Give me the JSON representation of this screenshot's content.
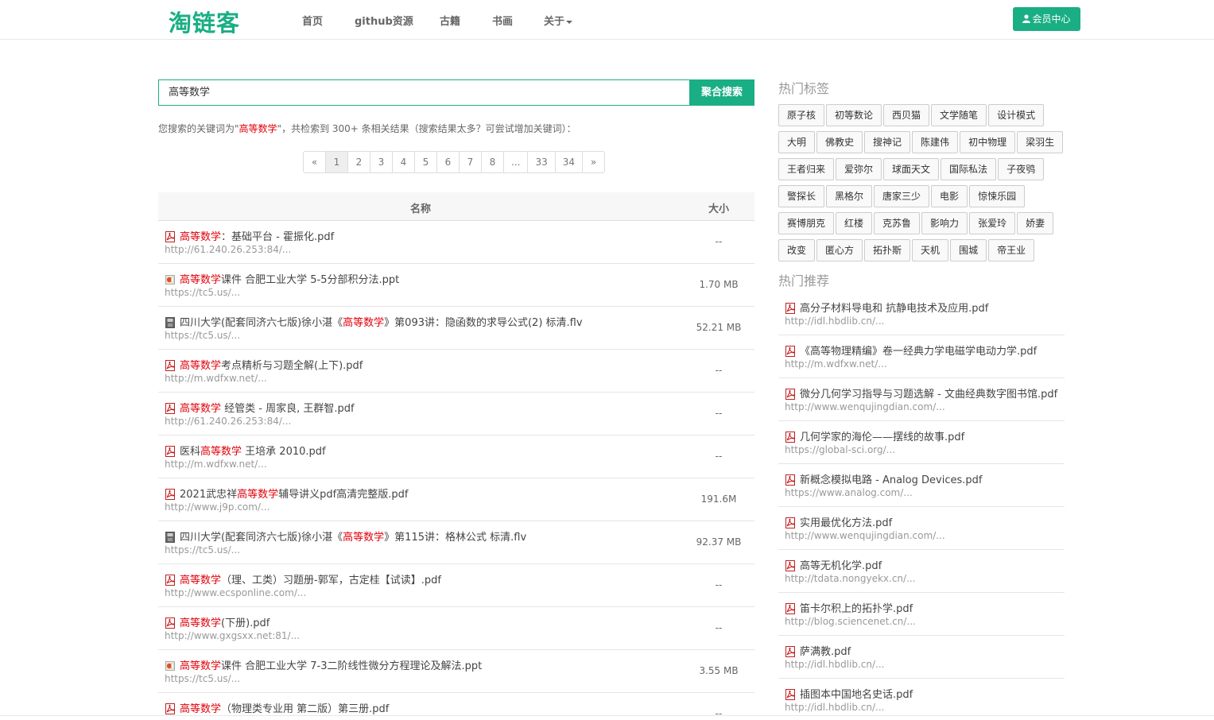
{
  "brand": {
    "logo": "淘链客",
    "accent": "#1aae84",
    "highlight": "#e0000a"
  },
  "nav": {
    "items": [
      {
        "label": "首页"
      },
      {
        "label": "github资源"
      },
      {
        "label": "古籍"
      },
      {
        "label": "书画"
      },
      {
        "label": "关于",
        "dropdown": true
      }
    ],
    "member_label": "会员中心"
  },
  "search": {
    "value": "高等数学",
    "button": "聚合搜索"
  },
  "summary": {
    "prefix": "您搜索的关键词为\"",
    "keyword": "高等数学",
    "suffix": "\"，共检索到 300+ 条相关结果（搜索结果太多？可尝试增加关键词）："
  },
  "pagination": [
    "«",
    "1",
    "2",
    "3",
    "4",
    "5",
    "6",
    "7",
    "8",
    "...",
    "33",
    "34",
    "»"
  ],
  "pagination_active": "1",
  "table": {
    "headers": {
      "name": "名称",
      "size": "大小"
    },
    "rows": [
      {
        "icon": "pdf-icon",
        "pre": "",
        "hl": "高等数学",
        "post": "：基础平台 - 霍振化.pdf",
        "url": "http://61.240.26.253:84/...",
        "size": "--"
      },
      {
        "icon": "ppt-icon",
        "pre": "",
        "hl": "高等数学",
        "post": "课件 合肥工业大学 5-5分部积分法.ppt",
        "url": "https://tc5.us/...",
        "size": "1.70 MB"
      },
      {
        "icon": "video-icon",
        "pre": "四川大学(配套同济六七版)徐小湛《",
        "hl": "高等数学",
        "post": "》第093讲：隐函数的求导公式(2) 标清.flv",
        "url": "https://tc5.us/...",
        "size": "52.21 MB"
      },
      {
        "icon": "pdf-icon",
        "pre": "",
        "hl": "高等数学",
        "post": "考点精析与习题全解(上下).pdf",
        "url": "http://m.wdfxw.net/...",
        "size": "--"
      },
      {
        "icon": "pdf-icon",
        "pre": "",
        "hl": "高等数学",
        "post": " 经管类 - 周家良, 王群智.pdf",
        "url": "http://61.240.26.253:84/...",
        "size": "--"
      },
      {
        "icon": "pdf-icon",
        "pre": "医科",
        "hl": "高等数学",
        "post": " 王培承 2010.pdf",
        "url": "http://m.wdfxw.net/...",
        "size": "--"
      },
      {
        "icon": "pdf-icon",
        "pre": "2021武忠祥",
        "hl": "高等数学",
        "post": "辅导讲义pdf高清完整版.pdf",
        "url": "http://www.j9p.com/...",
        "size": "191.6M"
      },
      {
        "icon": "video-icon",
        "pre": "四川大学(配套同济六七版)徐小湛《",
        "hl": "高等数学",
        "post": "》第115讲：格林公式 标清.flv",
        "url": "https://tc5.us/...",
        "size": "92.37 MB"
      },
      {
        "icon": "pdf-icon",
        "pre": "",
        "hl": "高等数学",
        "post": "（理、工类）习题册-郭军，古定桂【试读】.pdf",
        "url": "http://www.ecsponline.com/...",
        "size": "--"
      },
      {
        "icon": "pdf-icon",
        "pre": "",
        "hl": "高等数学",
        "post": "(下册).pdf",
        "url": "http://www.gxgsxx.net:81/...",
        "size": "--"
      },
      {
        "icon": "ppt-icon",
        "pre": "",
        "hl": "高等数学",
        "post": "课件 合肥工业大学 7-3二阶线性微分方程理论及解法.ppt",
        "url": "https://tc5.us/...",
        "size": "3.55 MB"
      },
      {
        "icon": "pdf-icon",
        "pre": "",
        "hl": "高等数学",
        "post": "（物理类专业用 第二版）第三册.pdf",
        "url": "",
        "size": "--"
      }
    ]
  },
  "sidebar": {
    "tags_title": "热门标签",
    "tag_rows": [
      [
        "原子核",
        "初等数论",
        "西贝猫",
        "文学随笔",
        "设计模式"
      ],
      [
        "大明",
        "佛教史",
        "搜神记",
        "陈建伟",
        "初中物理",
        "梁羽生"
      ],
      [
        "王者归来",
        "爱弥尔",
        "球面天文",
        "国际私法",
        "子夜鸮"
      ],
      [
        "警探长",
        "黑格尔",
        "唐家三少",
        "电影",
        "惊悚乐园"
      ],
      [
        "赛博朋克",
        "红楼",
        "克苏鲁",
        "影响力",
        "张爱玲",
        "娇妻"
      ],
      [
        "改变",
        "匿心方",
        "拓扑斯",
        "天机",
        "围城",
        "帝王业"
      ]
    ],
    "rec_title": "热门推荐",
    "recs": [
      {
        "title": "高分子材料导电和 抗静电技术及应用.pdf",
        "url": "http://idl.hbdlib.cn/..."
      },
      {
        "title": "《高等物理精编》卷一经典力学电磁学电动力学.pdf",
        "url": "http://m.wdfxw.net/..."
      },
      {
        "title": "微分几何学习指导与习题选解 - 文曲经典数字图书馆.pdf",
        "url": "http://www.wenqujingdian.com/..."
      },
      {
        "title": "几何学家的海伦——摆线的故事.pdf",
        "url": "https://global-sci.org/..."
      },
      {
        "title": "新概念模拟电路 - Analog Devices.pdf",
        "url": "https://www.analog.com/..."
      },
      {
        "title": "实用最优化方法.pdf",
        "url": "http://www.wenqujingdian.com/..."
      },
      {
        "title": "高等无机化学.pdf",
        "url": "http://tdata.nongyekx.cn/..."
      },
      {
        "title": "笛卡尔积上的拓扑学.pdf",
        "url": "http://blog.sciencenet.cn/..."
      },
      {
        "title": "萨满教.pdf",
        "url": "http://idl.hbdlib.cn/..."
      },
      {
        "title": "插图本中国地名史话.pdf",
        "url": "http://idl.hbdlib.cn/..."
      }
    ]
  }
}
